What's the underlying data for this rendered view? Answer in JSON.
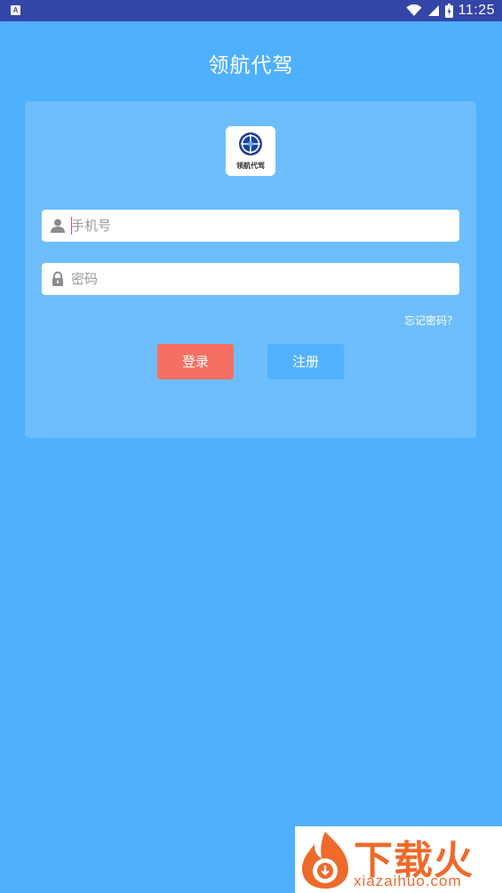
{
  "status_bar": {
    "app_icon_letter": "A",
    "time": "11:25",
    "icons": [
      "wifi-icon",
      "signal-icon",
      "battery-icon"
    ]
  },
  "header": {
    "title": "领航代驾"
  },
  "login_card": {
    "logo_text": "领航代驾",
    "phone_field": {
      "placeholder": "手机号",
      "value": "",
      "icon": "person-icon"
    },
    "password_field": {
      "placeholder": "密码",
      "value": "",
      "icon": "lock-icon"
    },
    "forgot_password_label": "忘记密码？",
    "login_label": "登录",
    "register_label": "注册"
  },
  "watermark": {
    "brand": "下载火",
    "url": "xiazaihuo.com"
  },
  "colors": {
    "background": "#4fb0fd",
    "status_bar": "#3445a8",
    "card": "#6ebefd",
    "login_button": "#f56f63",
    "register_button": "#51b2fd",
    "watermark_brand": "#ee6a2a"
  }
}
